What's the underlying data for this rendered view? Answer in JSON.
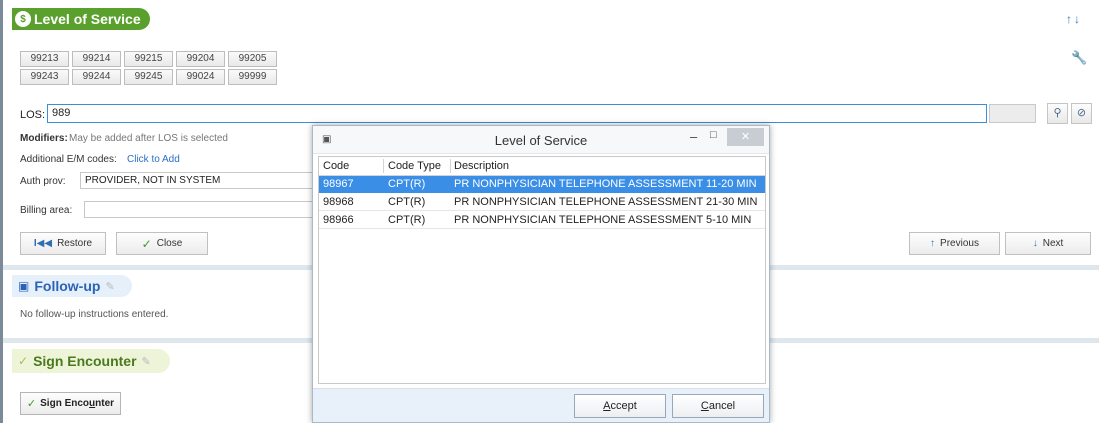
{
  "level_of_service": {
    "title": "Level of Service",
    "codes": [
      "99213",
      "99214",
      "99215",
      "99204",
      "99205",
      "99243",
      "99244",
      "99245",
      "99024",
      "99999"
    ],
    "los_label": "LOS:",
    "los_value": "989",
    "modifiers_label": "Modifiers:",
    "modifiers_note": "May be added after LOS is selected",
    "additional_label": "Additional E/M codes:",
    "additional_link": "Click to Add",
    "auth_prov_label": "Auth prov:",
    "auth_prov_value": "PROVIDER, NOT IN SYSTEM",
    "billing_label": "Billing area:",
    "restore_label": "Restore",
    "close_label": "Close",
    "previous_label": "Previous",
    "next_label": "Next"
  },
  "followup": {
    "title": "Follow-up",
    "text": "No follow-up instructions entered."
  },
  "sign": {
    "title": "Sign Encounter",
    "button_pre": "Sign Enco",
    "button_ul": "u",
    "button_post": "nter"
  },
  "dialog": {
    "title": "Level of Service",
    "columns": [
      "Code",
      "Code Type",
      "Description"
    ],
    "rows": [
      {
        "code": "98967",
        "type": "CPT(R)",
        "desc": "PR NONPHYSICIAN TELEPHONE ASSESSMENT 11-20 MIN",
        "selected": true
      },
      {
        "code": "98968",
        "type": "CPT(R)",
        "desc": "PR NONPHYSICIAN TELEPHONE ASSESSMENT 21-30 MIN",
        "selected": false
      },
      {
        "code": "98966",
        "type": "CPT(R)",
        "desc": "PR NONPHYSICIAN TELEPHONE ASSESSMENT 5-10 MIN",
        "selected": false
      }
    ],
    "accept_ul": "A",
    "accept_rest": "ccept",
    "cancel_ul": "C",
    "cancel_rest": "ancel"
  },
  "icons": {
    "sort": "sort-up-down-icon",
    "wrench": "wrench-icon",
    "close_window": "close-icon"
  },
  "colors": {
    "los_header": "#5aa02c",
    "selection": "#3a8ee6",
    "link": "#2a6fc9"
  }
}
